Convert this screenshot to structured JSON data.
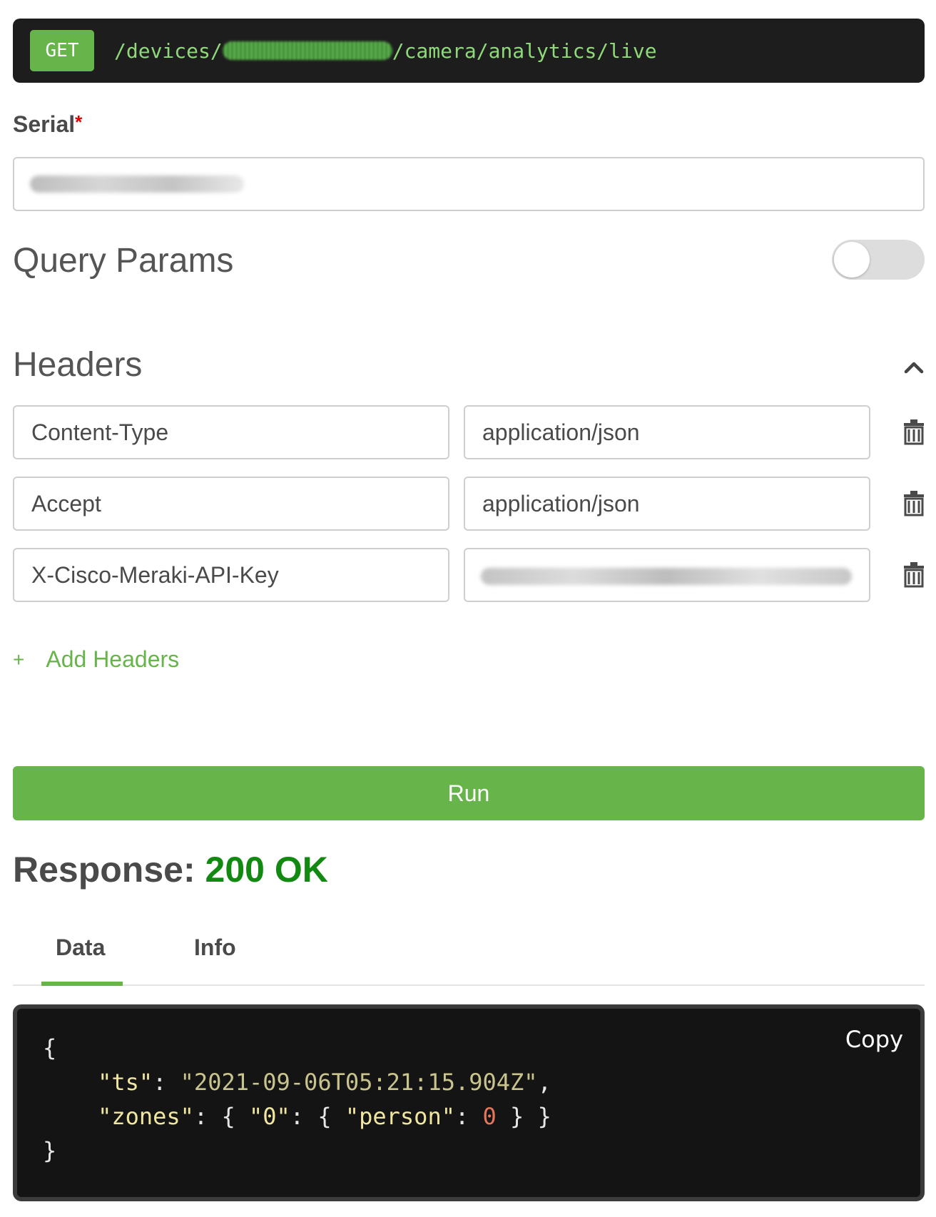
{
  "endpoint": {
    "method": "GET",
    "path_prefix": "/devices/",
    "path_suffix": "/camera/analytics/live"
  },
  "serial": {
    "label": "Serial",
    "required_mark": "*"
  },
  "query_params": {
    "title": "Query Params",
    "enabled": false
  },
  "headers": {
    "title": "Headers",
    "rows": [
      {
        "key": "Content-Type",
        "value": "application/json"
      },
      {
        "key": "Accept",
        "value": "application/json"
      },
      {
        "key": "X-Cisco-Meraki-API-Key",
        "value": ""
      }
    ],
    "add_label": "Add Headers",
    "add_icon": "+"
  },
  "run": {
    "label": "Run"
  },
  "response": {
    "label": "Response:",
    "status": "200  OK"
  },
  "tabs": [
    {
      "label": "Data",
      "active": true
    },
    {
      "label": "Info",
      "active": false
    }
  ],
  "code": {
    "copy_label": "Copy",
    "open_brace": "{",
    "close_brace": "}",
    "ts_key": "\"ts\"",
    "ts_value": "\"2021-09-06T05:21:15.904Z\"",
    "zones_key": "\"zones\"",
    "zone_id": "\"0\"",
    "person_key": "\"person\"",
    "person_value": "0"
  },
  "colors": {
    "accent": "#67b54a",
    "status_ok": "#128a12",
    "required": "#e00000",
    "code_bg": "#141414"
  }
}
